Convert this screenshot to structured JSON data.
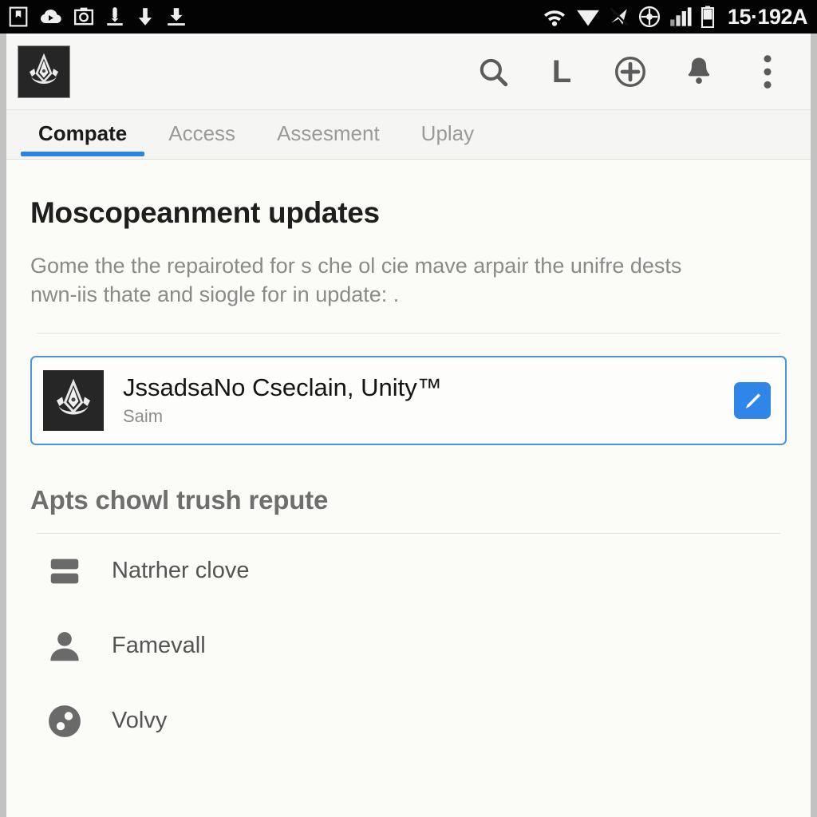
{
  "status_bar": {
    "clock": "15·192A",
    "left_icons": [
      "bookmark-screenshot-icon",
      "cloud-sync-icon",
      "camera-icon",
      "download-pin-icon",
      "download-arrow-icon",
      "download-complete-icon"
    ],
    "right_icons": [
      "wifi-icon",
      "signal-triangle-icon",
      "paper-plane-muted-icon",
      "location-compass-icon",
      "cellular-bars-icon",
      "battery-icon"
    ]
  },
  "app_bar": {
    "logo_name": "assassins-creed-emblem",
    "actions": [
      {
        "name": "search-icon",
        "label": "Search"
      },
      {
        "name": "letter-l-icon",
        "label": "L"
      },
      {
        "name": "add-circle-icon",
        "label": "Add"
      },
      {
        "name": "notifications-bell-icon",
        "label": "Notifications"
      },
      {
        "name": "overflow-menu-icon",
        "label": "More options"
      }
    ]
  },
  "tabs": [
    {
      "label": "Compate",
      "active": true
    },
    {
      "label": "Access",
      "active": false
    },
    {
      "label": "Assesment",
      "active": false
    },
    {
      "label": "Uplay",
      "active": false
    }
  ],
  "main": {
    "section_title": "Moscopeanment updates",
    "section_body_line1": "Gome the the repairoted for s che ol cie mave arpair the unifre dests",
    "section_body_line2": "nwn-iis thate and siogle for in update: .",
    "feature_card": {
      "thumb_name": "assassins-creed-emblem",
      "title": "JssadsaNo Cseclain, Unity™",
      "subtitle": "Saim",
      "edit_button_label": "Edit"
    },
    "list_heading": "Apts chowl trush repute",
    "list_items": [
      {
        "label": "Natrher clove",
        "icon": "database-icon"
      },
      {
        "label": "Famevall",
        "icon": "person-icon"
      },
      {
        "label": "Volvy",
        "icon": "dots-circle-icon"
      }
    ]
  },
  "colors": {
    "accent_blue": "#2a86e0",
    "card_border_blue": "#4a93dd",
    "edit_button_blue": "#2f86e8",
    "status_bar_black": "#030303",
    "content_background": "#fbfbf7",
    "app_bar_background": "#f7f7f5"
  }
}
